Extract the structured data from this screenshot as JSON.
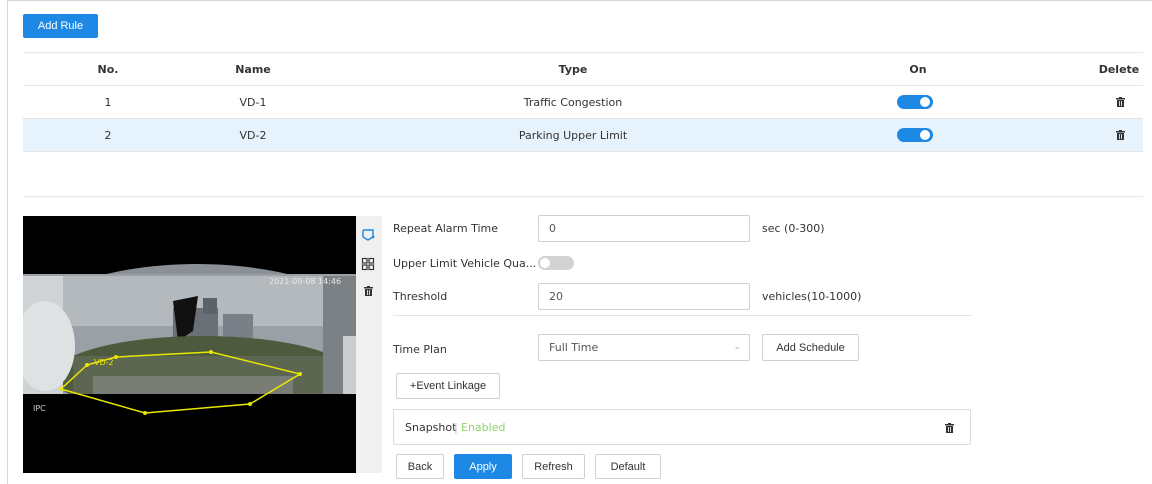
{
  "toolbar": {
    "add_rule": "Add Rule"
  },
  "table": {
    "headers": {
      "no": "No.",
      "name": "Name",
      "type": "Type",
      "on": "On",
      "delete": "Delete"
    },
    "rows": [
      {
        "no": "1",
        "name": "VD-1",
        "type": "Traffic Congestion",
        "on": true
      },
      {
        "no": "2",
        "name": "VD-2",
        "type": "Parking Upper Limit",
        "on": true
      }
    ]
  },
  "video": {
    "overlay_text": "2021-09-08 14:46",
    "region_label": "VD-2",
    "corner_text": "IPC"
  },
  "form": {
    "repeat_alarm": {
      "label": "Repeat Alarm Time",
      "value": "0",
      "unit": "sec (0-300)"
    },
    "upper_limit": {
      "label": "Upper Limit Vehicle Qua...",
      "on": false
    },
    "threshold": {
      "label": "Threshold",
      "value": "20",
      "unit": "vehicles(10-1000)"
    },
    "time_plan": {
      "label": "Time Plan",
      "value": "Full Time",
      "add_schedule": "Add Schedule"
    },
    "event_linkage": "+Event Linkage",
    "snapshot": {
      "label": "Snapshot",
      "status": "Enabled"
    }
  },
  "footer": {
    "back": "Back",
    "apply": "Apply",
    "refresh": "Refresh",
    "default": "Default"
  },
  "colors": {
    "accent": "#1e88e5",
    "selected_row": "#e6f3fc",
    "enabled": "#8ed26d",
    "region": "#e8e800"
  }
}
